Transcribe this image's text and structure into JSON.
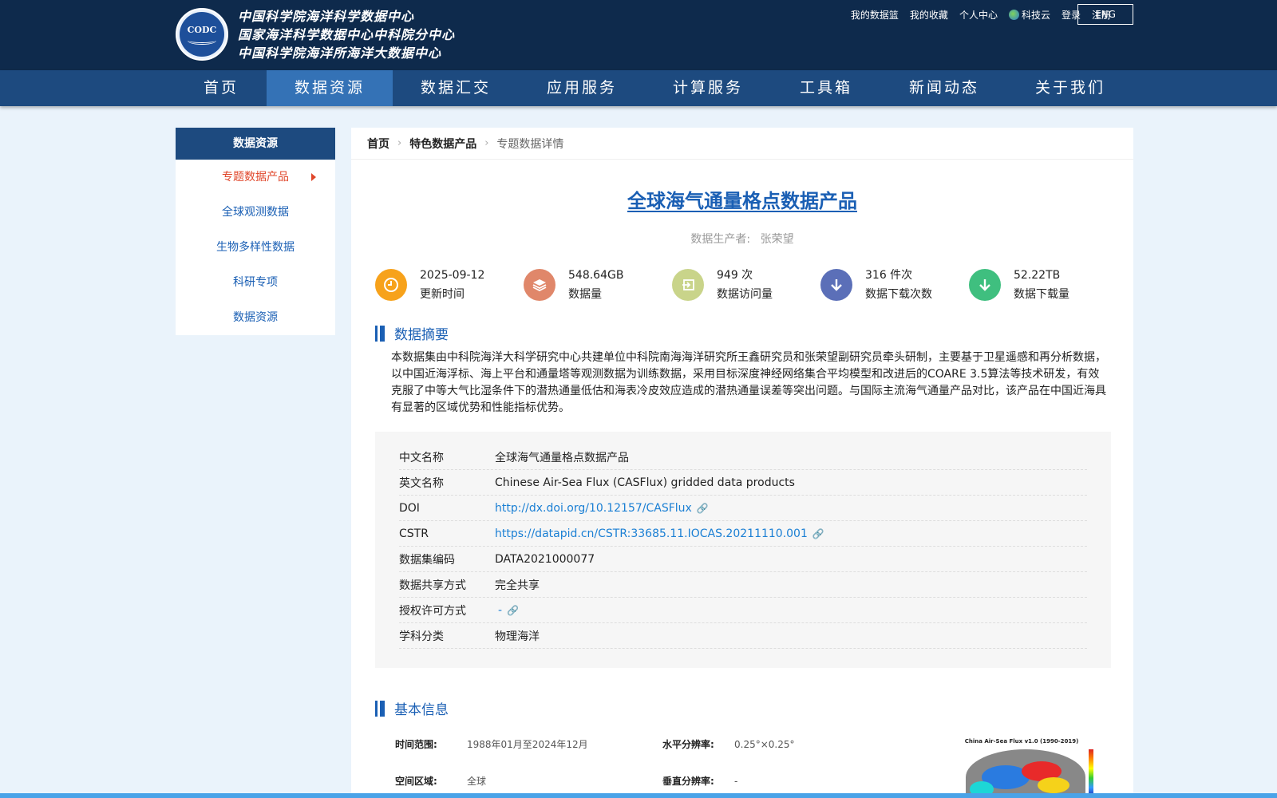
{
  "header": {
    "logo_text": "CODC",
    "site_names": [
      "中国科学院海洋科学数据中心",
      "国家海洋科学数据中心中科院分中心",
      "中国科学院海洋所海洋大数据中心"
    ],
    "top_links": [
      "我的数据篮",
      "我的收藏",
      "个人中心",
      "科技云",
      "登录",
      "注册"
    ],
    "lang_button": "ENG"
  },
  "nav": {
    "items": [
      "首页",
      "数据资源",
      "数据汇交",
      "应用服务",
      "计算服务",
      "工具箱",
      "新闻动态",
      "关于我们"
    ],
    "active": "数据资源"
  },
  "sidebar": {
    "title": "数据资源",
    "items": [
      "专题数据产品",
      "全球观测数据",
      "生物多样性数据",
      "科研专项",
      "数据资源"
    ]
  },
  "breadcrumb": [
    "首页",
    "特色数据产品",
    "专题数据详情"
  ],
  "dataset": {
    "title": "全球海气通量格点数据产品",
    "producer_label": "数据生产者:",
    "producer": "张荣望"
  },
  "stats": [
    {
      "value": "2025-09-12",
      "label": "更新时间",
      "color": "#f7a21b",
      "icon": "clock-icon"
    },
    {
      "value": "548.64GB",
      "label": "数据量",
      "color": "#e0876a",
      "icon": "layers-icon"
    },
    {
      "value": "949 次",
      "label": "数据访问量",
      "color": "#c9d48a",
      "icon": "enter-icon"
    },
    {
      "value": "316 件次",
      "label": "数据下载次数",
      "color": "#5b6fb8",
      "icon": "download-arrow-icon"
    },
    {
      "value": "52.22TB",
      "label": "数据下载量",
      "color": "#3fbf7f",
      "icon": "download-arrow-icon"
    }
  ],
  "abstract": {
    "title": "数据摘要",
    "text": "本数据集由中科院海洋大科学研究中心共建单位中科院南海海洋研究所王鑫研究员和张荣望副研究员牵头研制，主要基于卫星遥感和再分析数据，以中国近海浮标、海上平台和通量塔等观测数据为训练数据，采用目标深度神经网络集合平均模型和改进后的COARE 3.5算法等技术研发，有效克服了中等大气比湿条件下的潜热通量低估和海表冷皮效应造成的潜热通量误差等突出问题。与国际主流海气通量产品对比，该产品在中国近海具有显著的区域优势和性能指标优势。"
  },
  "info": [
    {
      "key": "中文名称",
      "value": "全球海气通量格点数据产品",
      "link": false
    },
    {
      "key": "英文名称",
      "value": "Chinese Air-Sea Flux (CASFlux) gridded data products",
      "link": false
    },
    {
      "key": "DOI",
      "value": "http://dx.doi.org/10.12157/CASFlux",
      "link": true
    },
    {
      "key": "CSTR",
      "value": "https://datapid.cn/CSTR:33685.11.IOCAS.20211110.001",
      "link": true
    },
    {
      "key": "数据集编码",
      "value": "DATA2021000077",
      "link": false
    },
    {
      "key": "数据共享方式",
      "value": "完全共享",
      "link": false
    },
    {
      "key": "授权许可方式",
      "value": "-",
      "link": true
    },
    {
      "key": "学科分类",
      "value": "物理海洋",
      "link": false
    }
  ],
  "basic": {
    "title": "基本信息",
    "time_range_label": "时间范围:",
    "time_range": "1988年01月至2024年12月",
    "h_res_label": "水平分辨率:",
    "h_res": "0.25°×0.25°",
    "region_label": "空间区域:",
    "region": "全球",
    "v_res_label": "垂直分辨率:",
    "v_res": "-",
    "map_title": "China Air-Sea Flux v1.0 (1990-2019)"
  }
}
